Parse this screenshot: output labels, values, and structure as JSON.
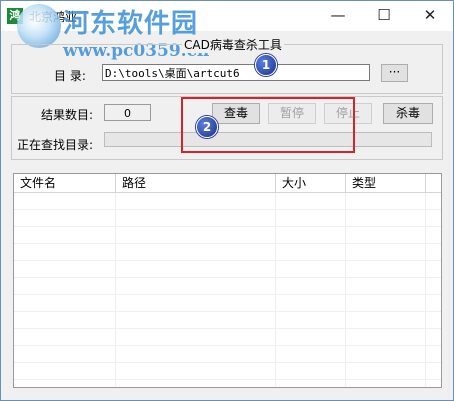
{
  "window": {
    "title": "北京鸿业",
    "app_icon": "app-icon",
    "controls": {
      "minimize": "—",
      "maximize": "☐",
      "close": "✕"
    }
  },
  "watermark": {
    "name": "河东软件园",
    "url": "www.pc0359.cn"
  },
  "group_title": "CAD病毒查杀工具",
  "directory": {
    "label": "目  录:",
    "value": "D:\\tools\\桌面\\artcut6",
    "browse_label": "···"
  },
  "results": {
    "count_label": "结果数目:",
    "count_value": "0",
    "searching_label": "正在查找目录:"
  },
  "buttons": {
    "scan": "查毒",
    "pause": "暂停",
    "stop": "停止",
    "kill": "杀毒"
  },
  "annotations": {
    "marker1": "1",
    "marker2": "2",
    "box_color": "#d3242b"
  },
  "table": {
    "columns": [
      "文件名",
      "路径",
      "大小",
      "类型"
    ],
    "rows": []
  }
}
